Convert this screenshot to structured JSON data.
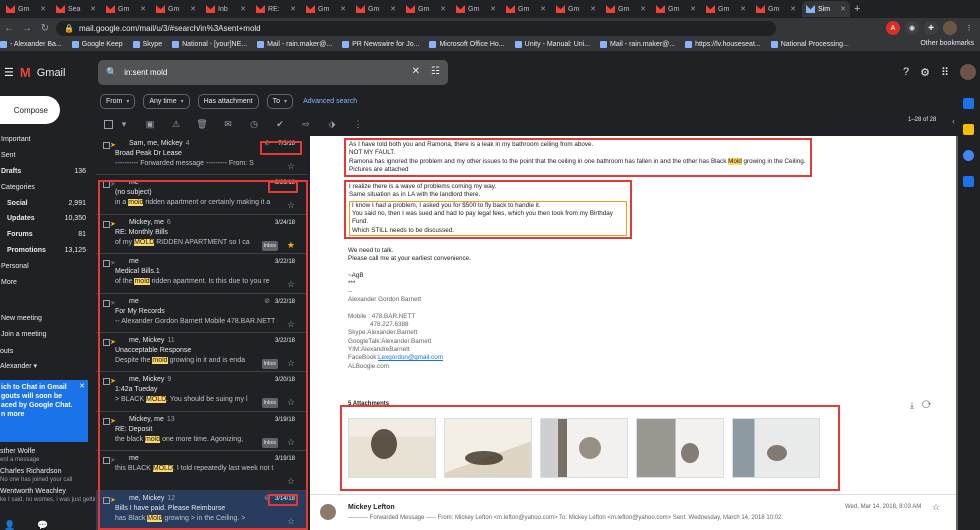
{
  "tabs": [
    {
      "label": "Gm"
    },
    {
      "label": "Sea"
    },
    {
      "label": "Gm"
    },
    {
      "label": "Gm"
    },
    {
      "label": "Inb"
    },
    {
      "label": "RE:"
    },
    {
      "label": "Gm"
    },
    {
      "label": "Gm"
    },
    {
      "label": "Gm"
    },
    {
      "label": "Gm"
    },
    {
      "label": "Gm"
    },
    {
      "label": "Gm"
    },
    {
      "label": "Gm"
    },
    {
      "label": "Gm"
    },
    {
      "label": "Gm"
    },
    {
      "label": "Gm"
    },
    {
      "label": "Sim"
    }
  ],
  "url": "mail.google.com/mail/u/3/#search/in%3Asent+mold",
  "bookmarks": [
    "- Alexander Ba...",
    "Google Keep",
    "Skype",
    "National - [your]NE...",
    "Mail - rain.maker@...",
    "PR Newswire for Jo...",
    "Microsoft Office Ho...",
    "Unity - Manual: Uni...",
    "Mail - rain.maker@...",
    "https://lv.houseseat...",
    "National Processing..."
  ],
  "bookmarks_other": "Other bookmarks",
  "app_name": "Gmail",
  "search": {
    "query": "in:sent mold"
  },
  "compose_label": "Compose",
  "nav": [
    {
      "label": "Important",
      "count": "",
      "sub": false,
      "bold": false
    },
    {
      "label": "Sent",
      "count": "",
      "sub": false,
      "bold": false
    },
    {
      "label": "Drafts",
      "count": "136",
      "sub": false,
      "bold": true
    },
    {
      "label": "Categories",
      "count": "",
      "sub": false,
      "bold": false
    },
    {
      "label": "Social",
      "count": "2,991",
      "sub": true,
      "bold": true
    },
    {
      "label": "Updates",
      "count": "10,350",
      "sub": true,
      "bold": true
    },
    {
      "label": "Forums",
      "count": "81",
      "sub": true,
      "bold": true
    },
    {
      "label": "Promotions",
      "count": "13,125",
      "sub": true,
      "bold": true
    },
    {
      "label": "Personal",
      "count": "",
      "sub": false,
      "bold": false
    },
    {
      "label": "More",
      "count": "",
      "sub": false,
      "bold": false
    }
  ],
  "meet": {
    "new": "New meeting",
    "join": "Join a meeting"
  },
  "hangouts": {
    "label": "outs",
    "user": "Alexander"
  },
  "chat_notice": {
    "text": "ich to Chat in Gmail gouts will soon be aced by Google Chat. n more"
  },
  "contacts": [
    {
      "name": "sther Wolfe",
      "detail": "ent a message"
    },
    {
      "name": "Charles Richardson",
      "detail": "No one has joined your call"
    },
    {
      "name": "Wentworth Weachley",
      "detail": "ke I said, no womes, i was just gettin"
    }
  ],
  "filters": {
    "from": "From",
    "time": "Any time",
    "attach": "Has attachment",
    "to": "To",
    "advanced": "Advanced search"
  },
  "pager": "1–28 of 28",
  "emails": [
    {
      "sender": "Sam, me, Mickey",
      "count": "4",
      "subject": "Broad Peak Dr Lease",
      "snippet": "---------- Forwarded message --------- From: S",
      "date": "7/3/18",
      "imp": true,
      "attach": true,
      "inbox": false,
      "starred": false,
      "selected": false
    },
    {
      "sender": "me",
      "count": "",
      "subject": "(no subject)",
      "snippet_pre": "in a ",
      "snippet_hl": "mold",
      "snippet_post": " ridden apartment or certainly making it a",
      "date": "3/26/18",
      "imp": false,
      "attach": false,
      "inbox": false,
      "starred": false,
      "selected": false
    },
    {
      "sender": "Mickey, me",
      "count": "6",
      "subject": "RE: Monthly Bills",
      "snippet_pre": "of my ",
      "snippet_hl": "MOLD",
      "snippet_post": " RIDDEN APARTMENT so I ca",
      "date": "3/24/18",
      "imp": true,
      "attach": false,
      "inbox": true,
      "starred": true,
      "selected": false
    },
    {
      "sender": "me",
      "count": "",
      "subject": "Medical Bills.1",
      "snippet_pre": "of the ",
      "snippet_hl": "mold",
      "snippet_post": " ridden apartment. Is this due to you re",
      "date": "3/22/18",
      "imp": false,
      "attach": false,
      "inbox": false,
      "starred": false,
      "selected": false
    },
    {
      "sender": "me",
      "count": "",
      "subject": "For My Records",
      "snippet": "-- Alexander Gordon Barnett Mobile 478.BAR.NETT",
      "date": "3/22/18",
      "imp": false,
      "attach": true,
      "inbox": false,
      "starred": false,
      "selected": false
    },
    {
      "sender": "me, Mickey",
      "count": "11",
      "subject": "Unacceptable Response",
      "snippet_pre": "Despite the ",
      "snippet_hl": "mold",
      "snippet_post": " growing in it and is enda",
      "date": "3/22/18",
      "imp": true,
      "attach": false,
      "inbox": true,
      "starred": false,
      "selected": false
    },
    {
      "sender": "me, Mickey",
      "count": "9",
      "subject": "1:42a Tueday",
      "snippet_pre": "> BLACK ",
      "snippet_hl": "MOLD",
      "snippet_post": ". You should be suing my l",
      "date": "3/20/18",
      "imp": true,
      "attach": false,
      "inbox": true,
      "starred": false,
      "selected": false
    },
    {
      "sender": "Mickey, me",
      "count": "13",
      "subject": "RE: Deposit",
      "snippet_pre": "the black ",
      "snippet_hl": "mold",
      "snippet_post": " one more time. Agonizing,",
      "date": "3/19/18",
      "imp": true,
      "attach": false,
      "inbox": true,
      "starred": false,
      "selected": false
    },
    {
      "sender": "me",
      "count": "",
      "subject": "",
      "snippet_pre": "this BLACK ",
      "snippet_hl": "MOLD",
      "snippet_post": ". I told repeatedly last week not t",
      "date": "3/19/18",
      "imp": false,
      "attach": false,
      "inbox": false,
      "starred": false,
      "selected": false
    },
    {
      "sender": "me, Mickey",
      "count": "12",
      "subject": "Bills I have paid. Please Reimburse",
      "snippet_pre": "has Black ",
      "snippet_hl": "Mold",
      "snippet_post": " growing > in the Ceiling. >",
      "date": "3/14/18",
      "imp": true,
      "attach": true,
      "inbox": false,
      "starred": false,
      "selected": true
    }
  ],
  "message": {
    "para1": [
      "As I have told both you and Ramona, there is a leak in my bathroom ceiling from above.",
      "NOT MY FAULT.",
      "Ramona has ignored the problem and my other issues to the point that the ceiling in one bathroom has fallen in and the other has Black ",
      "Mold",
      " growing in the Ceiling.",
      "Pictures are attached"
    ],
    "para2": [
      "I realize there is a wave of problems coming my way.",
      "Same situation as in LA with the landlord there."
    ],
    "para2_inner": [
      "I know I had a problem, I asked you for $500 to fly back to handle it.",
      "You said no, then I was sued and had to pay legal fees, which you then took from my Birthday Fund.",
      "Which STILL needs to be discussed."
    ],
    "para3": [
      "We need to talk.",
      "Please call me at your earliest convenience."
    ],
    "signoff": [
      "~AgB",
      "***",
      "--",
      "Alexander Gordon Barnett"
    ],
    "signature": [
      "Mobile : 478.BAR.NETT",
      "478.227.6388",
      "Skype:Alexander.Barnett",
      "GoogleTalk:Alexander.Barnett",
      "YIM:AlexandreBarnett",
      "FaceBook:",
      "Lexgordon@gmail.com",
      "ALBoogie.com"
    ],
    "attachments_label": "5 Attachments"
  },
  "next_message": {
    "sender": "Mickey Lefton",
    "snippet": "---------- Forwarded Message ----- From: Mickey Lefton <m.lefton@yahoo.com> To: Mickey Lefton <m.lefton@yahoo.com> Sent: Wednesday, March 14, 2018 10:02:",
    "date": "Wed, Mar 14, 2018, 8:03 AM"
  }
}
